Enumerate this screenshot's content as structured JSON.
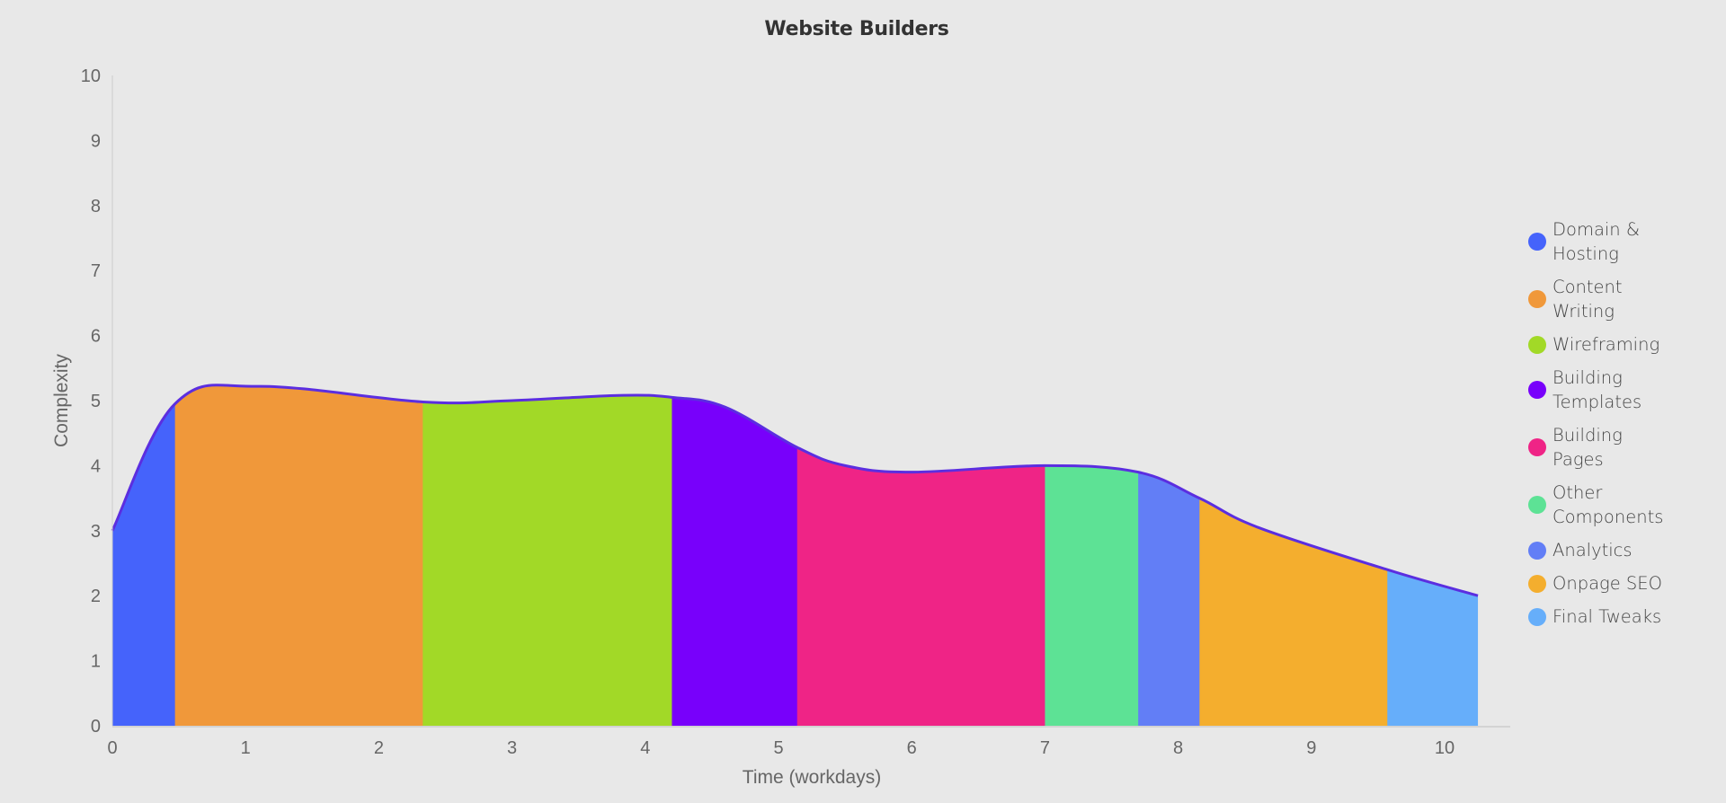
{
  "chart_data": {
    "type": "area",
    "title": "Website Builders",
    "xlabel": "Time (workdays)",
    "ylabel": "Complexity",
    "xlim": [
      0,
      10.5
    ],
    "ylim": [
      0,
      10
    ],
    "xticks": [
      "0",
      "1",
      "2",
      "3",
      "4",
      "5",
      "6",
      "7",
      "8",
      "9",
      "10"
    ],
    "yticks": [
      "0",
      "1",
      "2",
      "3",
      "4",
      "5",
      "6",
      "7",
      "8",
      "9",
      "10"
    ],
    "grid": false,
    "legend_position": "right",
    "line_color": "#5b2ee0",
    "curve": {
      "x": [
        0,
        0.47,
        1.1,
        2.33,
        3.0,
        3.8,
        4.2,
        4.6,
        5.14,
        5.5,
        6.0,
        7.0,
        7.7,
        8.16,
        8.6,
        9.57,
        10.25
      ],
      "y": [
        3.0,
        4.95,
        5.22,
        4.98,
        5.0,
        5.08,
        5.05,
        4.9,
        4.28,
        4.0,
        3.9,
        4.0,
        3.9,
        3.5,
        3.05,
        2.4,
        2.0
      ]
    },
    "series": [
      {
        "name": "Domain & Hosting",
        "start": 0,
        "end": 0.47,
        "color": "#4563fb"
      },
      {
        "name": "Content Writing",
        "start": 0.47,
        "end": 2.33,
        "color": "#f0983a"
      },
      {
        "name": "Wireframing",
        "start": 2.33,
        "end": 4.2,
        "color": "#a2d927"
      },
      {
        "name": "Building Templates",
        "start": 4.2,
        "end": 5.14,
        "color": "#7800fb"
      },
      {
        "name": "Building Pages",
        "start": 5.14,
        "end": 7.0,
        "color": "#ef2486"
      },
      {
        "name": "Other Components",
        "start": 7.0,
        "end": 7.7,
        "color": "#5de295"
      },
      {
        "name": "Analytics",
        "start": 7.7,
        "end": 8.16,
        "color": "#627ef6"
      },
      {
        "name": "Onpage SEO",
        "start": 8.16,
        "end": 9.57,
        "color": "#f4ae2e"
      },
      {
        "name": "Final Tweaks",
        "start": 9.57,
        "end": 10.25,
        "color": "#66aefa"
      }
    ]
  }
}
